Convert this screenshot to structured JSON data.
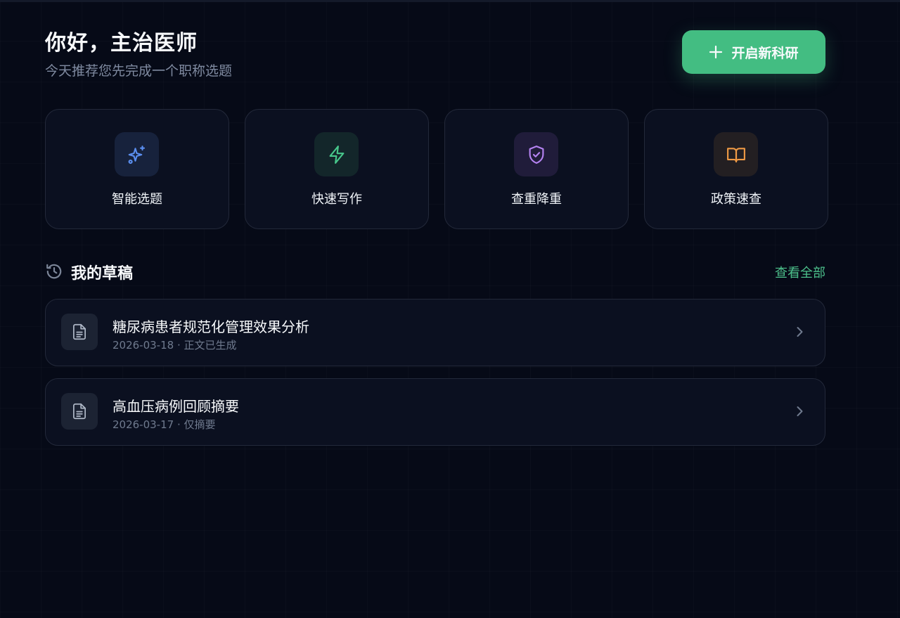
{
  "header": {
    "greeting": "你好，主治医师",
    "subtitle": "今天推荐您先完成一个职称选题",
    "new_button_label": "开启新科研"
  },
  "features": [
    {
      "label": "智能选题",
      "icon": "sparkles-icon",
      "color": "#5b8ff0",
      "bg": "#17223c"
    },
    {
      "label": "快速写作",
      "icon": "lightning-icon",
      "color": "#48c88c",
      "bg": "#13262a"
    },
    {
      "label": "查重降重",
      "icon": "shield-check-icon",
      "color": "#b583f2",
      "bg": "#201c3a"
    },
    {
      "label": "政策速查",
      "icon": "book-open-icon",
      "color": "#ef9a45",
      "bg": "#231f22"
    }
  ],
  "drafts": {
    "title": "我的草稿",
    "view_all_label": "查看全部",
    "items": [
      {
        "title": "糖尿病患者规范化管理效果分析",
        "meta": "2026-03-18 · 正文已生成"
      },
      {
        "title": "高血压病例回顾摘要",
        "meta": "2026-03-17 · 仅摘要"
      }
    ]
  },
  "colors": {
    "background": "#060a17",
    "accent": "#43bd82",
    "card_bg": "#0b1020",
    "card_border": "#23293a"
  }
}
